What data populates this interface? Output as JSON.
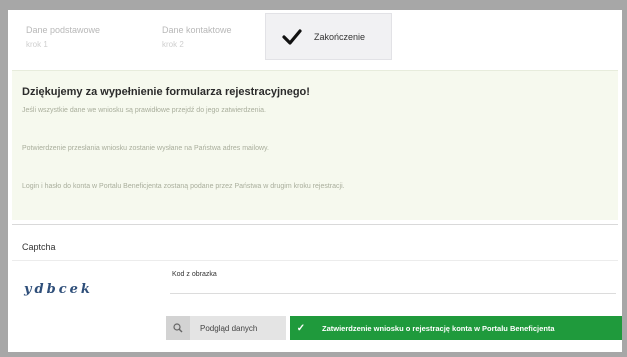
{
  "steps": [
    {
      "title": "Dane podstawowe",
      "subtitle": "krok 1"
    },
    {
      "title": "Dane kontaktowe",
      "subtitle": "krok 2"
    },
    {
      "title": "Zakończenie"
    }
  ],
  "notice": {
    "heading": "Dziękujemy za wypełnienie formularza rejestracyjnego!",
    "lines": [
      "Jeśli wszystkie dane we wniosku są prawidłowe przejdź do jego zatwierdzenia.",
      "Potwierdzenie przesłania wniosku zostanie wysłane na Państwa adres mailowy.",
      "Login i hasło do konta w Portalu Beneficjenta zostaną podane przez Państwa w drugim kroku rejestracji."
    ]
  },
  "captcha": {
    "label": "Captcha",
    "image_text": "ydbcek",
    "code_label": "Kod z obrazka",
    "code_value": ""
  },
  "buttons": {
    "preview_label": "Podgląd danych",
    "preview_icon": "search-icon",
    "confirm_label": "Zatwierdzenie wniosku o rejestrację konta w Portalu Beneficjenta",
    "confirm_icon": "check-icon"
  },
  "colors": {
    "confirm_button": "#1f9a3c",
    "notice_background": "#f6f9ee"
  }
}
